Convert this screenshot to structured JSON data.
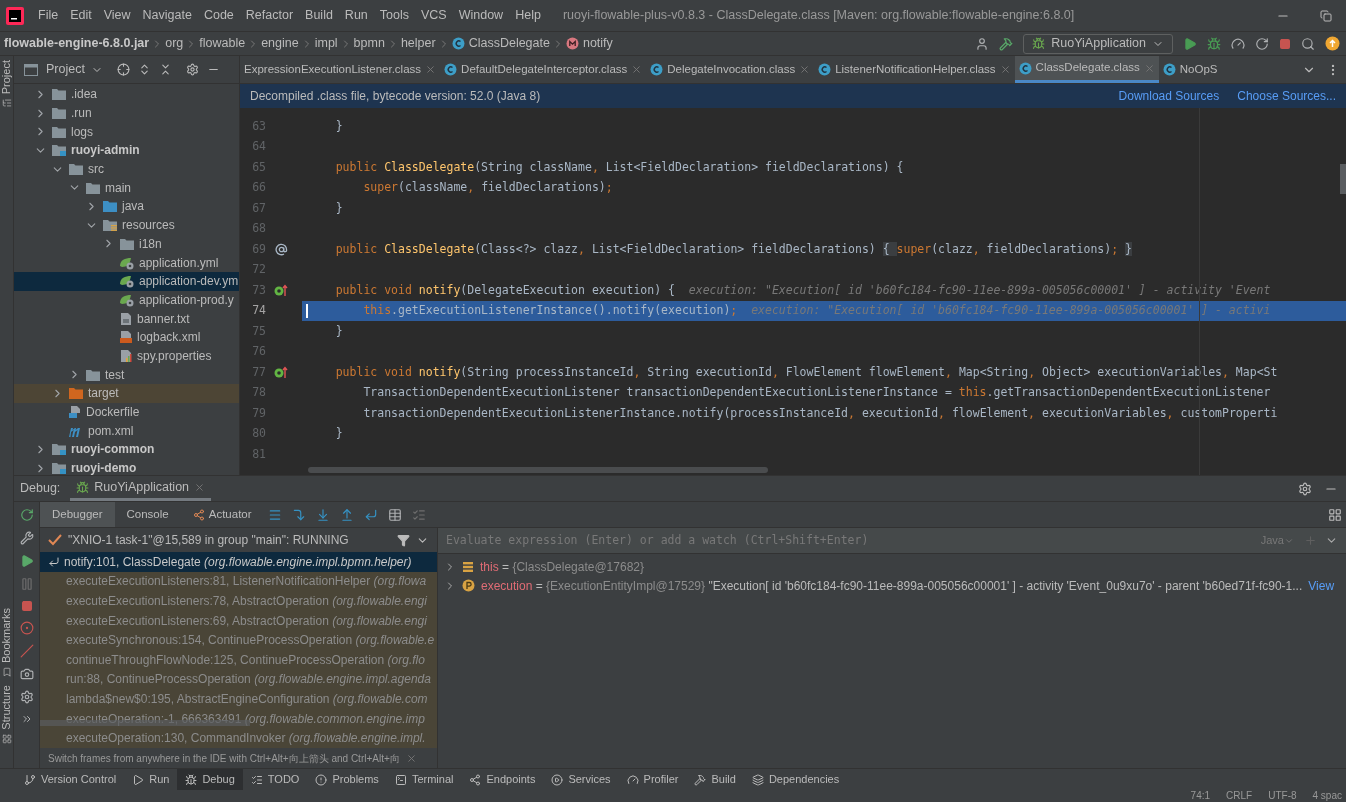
{
  "window": {
    "title": "ruoyi-flowable-plus-v0.8.3 - ClassDelegate.class [Maven: org.flowable:flowable-engine:6.8.0]"
  },
  "menu": [
    "File",
    "Edit",
    "View",
    "Navigate",
    "Code",
    "Refactor",
    "Build",
    "Run",
    "Tools",
    "VCS",
    "Window",
    "Help"
  ],
  "breadcrumb": [
    {
      "label": "flowable-engine-6.8.0.jar",
      "kind": "jar"
    },
    {
      "label": "org",
      "kind": "package"
    },
    {
      "label": "flowable",
      "kind": "package"
    },
    {
      "label": "engine",
      "kind": "package"
    },
    {
      "label": "impl",
      "kind": "package"
    },
    {
      "label": "bpmn",
      "kind": "package"
    },
    {
      "label": "helper",
      "kind": "package"
    },
    {
      "label": "ClassDelegate",
      "kind": "class"
    },
    {
      "label": "notify",
      "kind": "method"
    }
  ],
  "run_config": "RuoYiApplication",
  "project_panel": {
    "title": "Project",
    "tree": [
      {
        "label": ".idea",
        "kind": "folder",
        "expanded": false,
        "selected": false
      },
      {
        "label": ".run",
        "kind": "folder",
        "expanded": false,
        "selected": false
      },
      {
        "label": "logs",
        "kind": "folder",
        "expanded": false,
        "selected": false
      },
      {
        "label": "ruoyi-admin",
        "kind": "module",
        "expanded": true,
        "selected": false,
        "children": [
          {
            "label": "src",
            "kind": "folder",
            "expanded": true,
            "selected": false,
            "children": [
              {
                "label": "main",
                "kind": "folder",
                "expanded": true,
                "selected": false,
                "children": [
                  {
                    "label": "java",
                    "kind": "source",
                    "expanded": false,
                    "selected": false
                  },
                  {
                    "label": "resources",
                    "kind": "resources",
                    "expanded": true,
                    "selected": false,
                    "children": [
                      {
                        "label": "i18n",
                        "kind": "folder",
                        "expanded": false,
                        "selected": false
                      },
                      {
                        "label": "application.yml",
                        "kind": "yaml",
                        "selected": false
                      },
                      {
                        "label": "application-dev.ym",
                        "kind": "yaml",
                        "selected": true
                      },
                      {
                        "label": "application-prod.y",
                        "kind": "yaml",
                        "selected": false
                      },
                      {
                        "label": "banner.txt",
                        "kind": "text",
                        "selected": false
                      },
                      {
                        "label": "logback.xml",
                        "kind": "xml",
                        "selected": false
                      },
                      {
                        "label": "spy.properties",
                        "kind": "properties",
                        "selected": false
                      }
                    ]
                  }
                ]
              },
              {
                "label": "test",
                "kind": "folder",
                "expanded": false,
                "selected": false
              }
            ]
          },
          {
            "label": "target",
            "kind": "excluded",
            "expanded": false,
            "selected": false
          },
          {
            "label": "Dockerfile",
            "kind": "docker",
            "selected": false
          },
          {
            "label": "pom.xml",
            "kind": "maven",
            "selected": false
          }
        ]
      },
      {
        "label": "ruoyi-common",
        "kind": "module",
        "expanded": false,
        "selected": false
      },
      {
        "label": "ruoyi-demo",
        "kind": "module",
        "expanded": false,
        "selected": false
      }
    ]
  },
  "editor_tabs": [
    {
      "label": "ExpressionExecutionListener.class",
      "selected": false
    },
    {
      "label": "DefaultDelegateInterceptor.class",
      "selected": false
    },
    {
      "label": "DelegateInvocation.class",
      "selected": false
    },
    {
      "label": "ListenerNotificationHelper.class",
      "selected": false
    },
    {
      "label": "ClassDelegate.class",
      "selected": true
    },
    {
      "label": "NoOpS",
      "selected": false
    }
  ],
  "banner": {
    "text": "Decompiled .class file, bytecode version: 52.0 (Java 8)",
    "links": [
      "Download Sources",
      "Choose Sources..."
    ]
  },
  "code": [
    {
      "number": "63",
      "current": false,
      "tokens": [
        {
          "kind": "plain",
          "text": "    }"
        }
      ]
    },
    {
      "number": "64",
      "current": false
    },
    {
      "number": "65",
      "current": false,
      "tokens": [
        {
          "kind": "keyword",
          "text": "    public "
        },
        {
          "kind": "method",
          "text": "ClassDelegate"
        },
        {
          "kind": "plain",
          "text": "(String className"
        },
        {
          "kind": "keyword",
          "text": ", "
        },
        {
          "kind": "plain",
          "text": "List<FieldDeclaration> fieldDeclarations) {"
        }
      ]
    },
    {
      "number": "66",
      "current": false,
      "tokens": [
        {
          "kind": "keyword",
          "text": "        super"
        },
        {
          "kind": "plain",
          "text": "(className"
        },
        {
          "kind": "keyword",
          "text": ", "
        },
        {
          "kind": "plain",
          "text": "fieldDeclarations)"
        },
        {
          "kind": "keyword",
          "text": ";"
        }
      ]
    },
    {
      "number": "67",
      "current": false,
      "tokens": [
        {
          "kind": "plain",
          "text": "    }"
        }
      ]
    },
    {
      "number": "68",
      "current": false
    },
    {
      "number": "69",
      "current": false,
      "gutter": {
        "kind": "annotation"
      },
      "tokens": [
        {
          "kind": "keyword",
          "text": "    public "
        },
        {
          "kind": "method",
          "text": "ClassDelegate"
        },
        {
          "kind": "plain",
          "text": "(Class<?> clazz"
        },
        {
          "kind": "keyword",
          "text": ", "
        },
        {
          "kind": "plain",
          "text": "List<FieldDeclaration> fieldDeclarations) "
        },
        {
          "kind": "fold",
          "text": "{ "
        },
        {
          "kind": "keyword",
          "text": "super"
        },
        {
          "kind": "plain",
          "text": "(clazz"
        },
        {
          "kind": "keyword",
          "text": ", "
        },
        {
          "kind": "plain",
          "text": "fieldDeclarations)"
        },
        {
          "kind": "keyword",
          "text": "; "
        },
        {
          "kind": "fold",
          "text": "}"
        }
      ]
    },
    {
      "number": "72",
      "current": false
    },
    {
      "number": "73",
      "current": false,
      "gutter": {
        "kind": "override"
      },
      "tokens": [
        {
          "kind": "keyword",
          "text": "    public void "
        },
        {
          "kind": "method",
          "text": "notify"
        },
        {
          "kind": "plain",
          "text": "(DelegateExecution execution) {  "
        },
        {
          "kind": "hint",
          "text": "execution: \"Execution[ id 'b60fc184-fc90-11ee-899a-005056c00001' ] - activity 'Event"
        }
      ]
    },
    {
      "number": "74",
      "current": true,
      "tokens": [
        {
          "kind": "keyword",
          "text": "        this"
        },
        {
          "kind": "plain",
          "text": ".getExecutionListenerInstance().notify(execution)"
        },
        {
          "kind": "keyword",
          "text": ";  "
        },
        {
          "kind": "hint",
          "text": "execution: \"Execution[ id 'b60fc184-fc90-11ee-899a-005056c00001' ] - activi"
        }
      ]
    },
    {
      "number": "75",
      "current": false,
      "tokens": [
        {
          "kind": "plain",
          "text": "    }"
        }
      ]
    },
    {
      "number": "76",
      "current": false
    },
    {
      "number": "77",
      "current": false,
      "gutter": {
        "kind": "override"
      },
      "tokens": [
        {
          "kind": "keyword",
          "text": "    public void "
        },
        {
          "kind": "method",
          "text": "notify"
        },
        {
          "kind": "plain",
          "text": "(String processInstanceId"
        },
        {
          "kind": "keyword",
          "text": ", "
        },
        {
          "kind": "plain",
          "text": "String executionId"
        },
        {
          "kind": "keyword",
          "text": ", "
        },
        {
          "kind": "plain",
          "text": "FlowElement flowElement"
        },
        {
          "kind": "keyword",
          "text": ", "
        },
        {
          "kind": "plain",
          "text": "Map<String"
        },
        {
          "kind": "keyword",
          "text": ", "
        },
        {
          "kind": "plain",
          "text": "Object> executionVariables"
        },
        {
          "kind": "keyword",
          "text": ", "
        },
        {
          "kind": "plain",
          "text": "Map<St"
        }
      ]
    },
    {
      "number": "78",
      "current": false,
      "tokens": [
        {
          "kind": "plain",
          "text": "        TransactionDependentExecutionListener transactionDependentExecutionListenerInstance = "
        },
        {
          "kind": "keyword",
          "text": "this"
        },
        {
          "kind": "plain",
          "text": ".getTransactionDependentExecutionListener"
        }
      ]
    },
    {
      "number": "79",
      "current": false,
      "tokens": [
        {
          "kind": "plain",
          "text": "        transactionDependentExecutionListenerInstance.notify(processInstanceId"
        },
        {
          "kind": "keyword",
          "text": ", "
        },
        {
          "kind": "plain",
          "text": "executionId"
        },
        {
          "kind": "keyword",
          "text": ", "
        },
        {
          "kind": "plain",
          "text": "flowElement"
        },
        {
          "kind": "keyword",
          "text": ", "
        },
        {
          "kind": "plain",
          "text": "executionVariables"
        },
        {
          "kind": "keyword",
          "text": ", "
        },
        {
          "kind": "plain",
          "text": "customProperti"
        }
      ]
    },
    {
      "number": "80",
      "current": false,
      "tokens": [
        {
          "kind": "plain",
          "text": "    }"
        }
      ]
    },
    {
      "number": "81",
      "current": false
    }
  ],
  "debug": {
    "label": "Debug:",
    "session": "RuoYiApplication",
    "tabs": [
      {
        "label": "Debugger",
        "selected": true
      },
      {
        "label": "Console",
        "selected": false
      },
      {
        "label": "Actuator",
        "selected": false
      }
    ],
    "thread": "\"XNIO-1 task-1\"@15,589 in group \"main\": RUNNING",
    "frames": [
      {
        "text": "notify:101, ClassDelegate",
        "package": "(org.flowable.engine.impl.bpmn.helper)",
        "selected": true
      },
      {
        "text": "executeExecutionListeners:81, ListenerNotificationHelper",
        "package": "(org.flowa",
        "selected": false
      },
      {
        "text": "executeExecutionListeners:78, AbstractOperation",
        "package": "(org.flowable.engi",
        "selected": false
      },
      {
        "text": "executeExecutionListeners:69, AbstractOperation",
        "package": "(org.flowable.engi",
        "selected": false
      },
      {
        "text": "executeSynchronous:154, ContinueProcessOperation",
        "package": "(org.flowable.e",
        "selected": false
      },
      {
        "text": "continueThroughFlowNode:125, ContinueProcessOperation",
        "package": "(org.flo",
        "selected": false
      },
      {
        "text": "run:88, ContinueProcessOperation",
        "package": "(org.flowable.engine.impl.agenda",
        "selected": false
      },
      {
        "text": "lambda$new$0:195, AbstractEngineConfiguration",
        "package": "(org.flowable.com",
        "selected": false
      },
      {
        "text": "executeOperation:-1, 666363491",
        "package": "(org.flowable.common.engine.imp",
        "selected": false
      },
      {
        "text": "executeOperation:130, CommandInvoker",
        "package": "(org.flowable.engine.impl.",
        "selected": false
      }
    ],
    "hint": "Switch frames from anywhere in the IDE with Ctrl+Alt+向上箭头 and Ctrl+Alt+向",
    "evaluate": {
      "placeholder": "Evaluate expression (Enter) or add a watch (Ctrl+Shift+Enter)",
      "language": "Java"
    },
    "variables": [
      {
        "kind": "field",
        "name": "this",
        "operator": "=",
        "ref": "{ClassDelegate@17682}"
      },
      {
        "kind": "parameter",
        "name": "execution",
        "operator": "=",
        "ref": "{ExecutionEntityImpl@17529}",
        "value": "\"Execution[ id 'b60fc184-fc90-11ee-899a-005056c00001' ] - activity 'Event_0u9xu7o' - parent 'b60ed71f-fc90-1...",
        "link": "View"
      }
    ]
  },
  "bottom_tabs": [
    {
      "label": "Version Control",
      "selected": false
    },
    {
      "label": "Run",
      "selected": false
    },
    {
      "label": "Debug",
      "selected": true
    },
    {
      "label": "TODO",
      "selected": false
    },
    {
      "label": "Problems",
      "selected": false
    },
    {
      "label": "Terminal",
      "selected": false
    },
    {
      "label": "Endpoints",
      "selected": false
    },
    {
      "label": "Services",
      "selected": false
    },
    {
      "label": "Profiler",
      "selected": false
    },
    {
      "label": "Build",
      "selected": false
    },
    {
      "label": "Dependencies",
      "selected": false
    }
  ],
  "side_tabs": {
    "top": [
      "Project"
    ],
    "bottom": [
      "Bookmarks",
      "Structure"
    ]
  },
  "status_bar": [
    "74:1",
    "CRLF",
    "UTF-8",
    "4 spac"
  ]
}
